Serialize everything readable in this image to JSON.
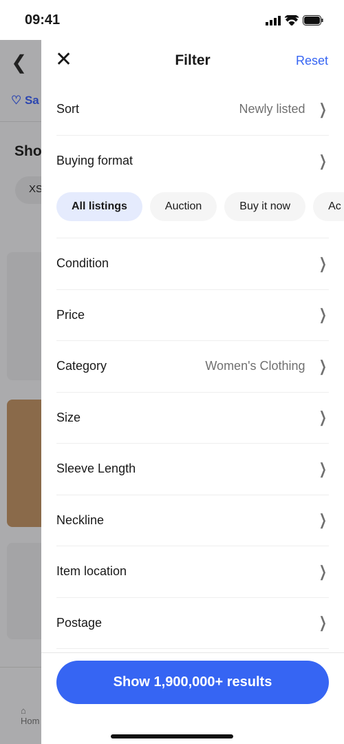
{
  "status_bar": {
    "time": "09:41"
  },
  "background": {
    "save_label": "Sa",
    "heading": "Sho",
    "chip": "XS",
    "home_label": "Hom"
  },
  "filter": {
    "title": "Filter",
    "reset": "Reset",
    "sort": {
      "label": "Sort",
      "value": "Newly listed"
    },
    "buying_format": {
      "label": "Buying format",
      "chips": [
        {
          "label": "All listings",
          "selected": true
        },
        {
          "label": "Auction"
        },
        {
          "label": "Buy it now"
        },
        {
          "label": "Ac"
        }
      ]
    },
    "rows": [
      {
        "label": "Condition",
        "value": ""
      },
      {
        "label": "Price",
        "value": ""
      },
      {
        "label": "Category",
        "value": "Women's Clothing"
      },
      {
        "label": "Size",
        "value": ""
      },
      {
        "label": "Sleeve Length",
        "value": ""
      },
      {
        "label": "Neckline",
        "value": ""
      },
      {
        "label": "Item location",
        "value": ""
      },
      {
        "label": "Postage",
        "value": ""
      }
    ],
    "cta": "Show 1,900,000+ results"
  },
  "colors": {
    "accent": "#3665f3",
    "chip_selected": "#e5ebfd"
  }
}
